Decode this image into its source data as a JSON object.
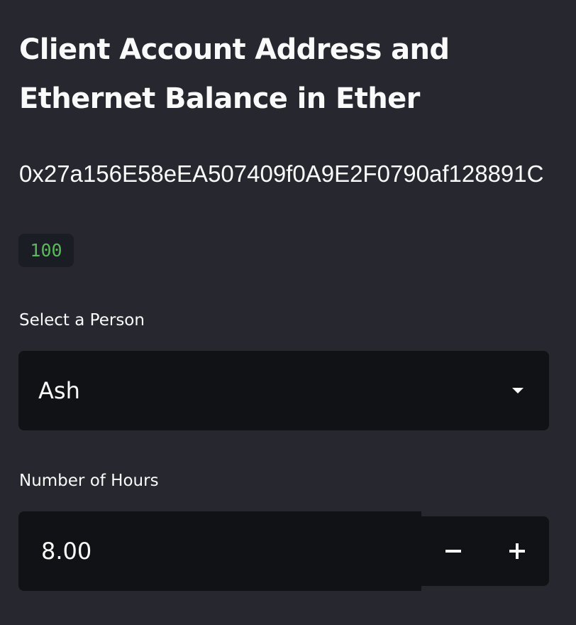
{
  "header": {
    "title": "Client Account Address and Ethernet Balance in Ether"
  },
  "account": {
    "address": "0x27a156E58eEA507409f0A9E2F0790af128891C",
    "balance": "100"
  },
  "person_select": {
    "label": "Select a Person",
    "selected_value": "Ash"
  },
  "hours_input": {
    "label": "Number of Hours",
    "value": "8.00"
  },
  "icons": {
    "select_caret": "caret-down-icon",
    "decrement": "minus-icon",
    "increment": "plus-icon"
  },
  "colors": {
    "background": "#26272f",
    "widget_background": "#111216",
    "text": "#fafafa",
    "balance_text": "#5cb85c"
  }
}
